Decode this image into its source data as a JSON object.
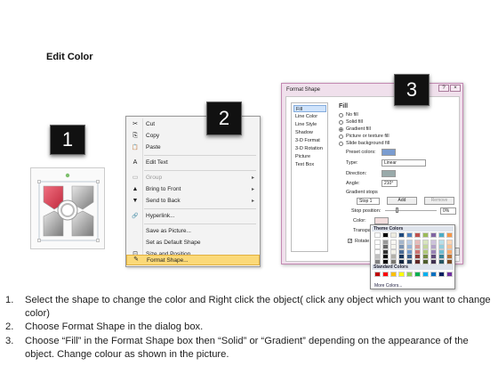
{
  "slide": {
    "title": "Edit Color"
  },
  "badges": [
    "1",
    "2",
    "3"
  ],
  "context_menu": {
    "items": [
      {
        "icon": "✂",
        "label": "Cut",
        "disabled": false,
        "arrow": false
      },
      {
        "icon": "⎘",
        "label": "Copy",
        "disabled": false,
        "arrow": false
      },
      {
        "icon": "📋",
        "label": "Paste",
        "disabled": false,
        "arrow": false
      },
      {
        "icon": "A",
        "label": "Edit Text",
        "disabled": false,
        "arrow": false
      },
      {
        "icon": "▭",
        "label": "Group",
        "disabled": true,
        "arrow": true
      },
      {
        "icon": "▲",
        "label": "Bring to Front",
        "disabled": false,
        "arrow": true
      },
      {
        "icon": "▼",
        "label": "Send to Back",
        "disabled": false,
        "arrow": true
      },
      {
        "icon": "🔗",
        "label": "Hyperlink...",
        "disabled": false,
        "arrow": false
      },
      {
        "icon": "",
        "label": "Save as Picture...",
        "disabled": false,
        "arrow": false
      },
      {
        "icon": "",
        "label": "Set as Default Shape",
        "disabled": false,
        "arrow": false
      },
      {
        "icon": "⊡",
        "label": "Size and Position...",
        "disabled": false,
        "arrow": false
      },
      {
        "icon": "✎",
        "label": "Format Shape...",
        "disabled": false,
        "arrow": false,
        "highlighted": true
      }
    ]
  },
  "dialog": {
    "title": "Format Shape",
    "categories": [
      "Fill",
      "Line Color",
      "Line Style",
      "Shadow",
      "3-D Format",
      "3-D Rotation",
      "Picture",
      "Text Box"
    ],
    "fill_heading": "Fill",
    "fill_options": [
      "No fill",
      "Solid fill",
      "Gradient fill",
      "Picture or texture fill",
      "Slide background fill"
    ],
    "selected_fill": "Gradient fill",
    "preset_colors_label": "Preset colors:",
    "type_label": "Type:",
    "type_value": "Linear",
    "direction_label": "Direction:",
    "angle_label": "Angle:",
    "angle_value": "210°",
    "gradient_stops_label": "Gradient stops",
    "stop_value": "Stop 1",
    "add_label": "Add",
    "remove_label": "Remove",
    "stop_position_label": "Stop position:",
    "stop_position_value": "0%",
    "color_label": "Color:",
    "transparency_label": "Transpa",
    "rotate_label": "Rotate",
    "close_label": "e",
    "help_label": "?",
    "close_icon": "×"
  },
  "palette": {
    "theme_label": "Theme Colors",
    "standard_label": "Standard Colors",
    "more_label": "More Colors...",
    "theme_top": [
      "#ffffff",
      "#000000",
      "#eeece1",
      "#1f497d",
      "#4f81bd",
      "#c0504d",
      "#9bbb59",
      "#8064a2",
      "#4bacc6",
      "#f79646"
    ],
    "standard": [
      "#c00000",
      "#ff0000",
      "#ffc000",
      "#ffff00",
      "#92d050",
      "#00b050",
      "#00b0f0",
      "#0070c0",
      "#002060",
      "#7030a0"
    ]
  },
  "instructions": [
    {
      "n": "1.",
      "text": "Select the shape to change the color and Right click the object( click any object which you want to change color)"
    },
    {
      "n": "2.",
      "text": "Choose Format Shape in the dialog box."
    },
    {
      "n": "3.",
      "text": "Choose “Fill” in the Format Shape box then “Solid” or “Gradient” depending on the appearance of the object. Change colour as shown in the picture."
    }
  ]
}
